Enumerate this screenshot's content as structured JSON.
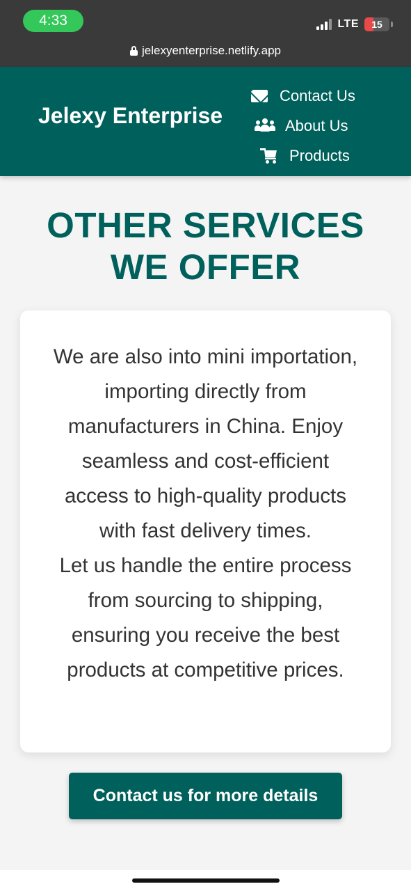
{
  "status_bar": {
    "time": "4:33",
    "network": "LTE",
    "battery_level": "15",
    "battery_fraction": 0.15
  },
  "browser": {
    "url": "jelexyenterprise.netlify.app"
  },
  "header": {
    "brand": "Jelexy Enterprise",
    "nav": [
      {
        "label": "Contact Us",
        "icon": "envelope-icon"
      },
      {
        "label": "About Us",
        "icon": "users-icon"
      },
      {
        "label": "Products",
        "icon": "shopping-cart-icon"
      }
    ]
  },
  "main": {
    "title_line1": "OTHER SERVICES",
    "title_line2": "WE OFFER",
    "paragraph1": "We are also into mini importation, importing directly from manufacturers in China. Enjoy seamless and cost-efficient access to high-quality products with fast delivery times.",
    "paragraph2": "Let us handle the entire process from sourcing to shipping, ensuring you receive the best products at competitive prices.",
    "cta_label": "Contact us for more details"
  },
  "colors": {
    "brand": "#00605b",
    "status_bar": "#3a3a3a",
    "time_pill": "#34c759",
    "battery_low": "#e84a4a",
    "background": "#f4f4f4"
  }
}
